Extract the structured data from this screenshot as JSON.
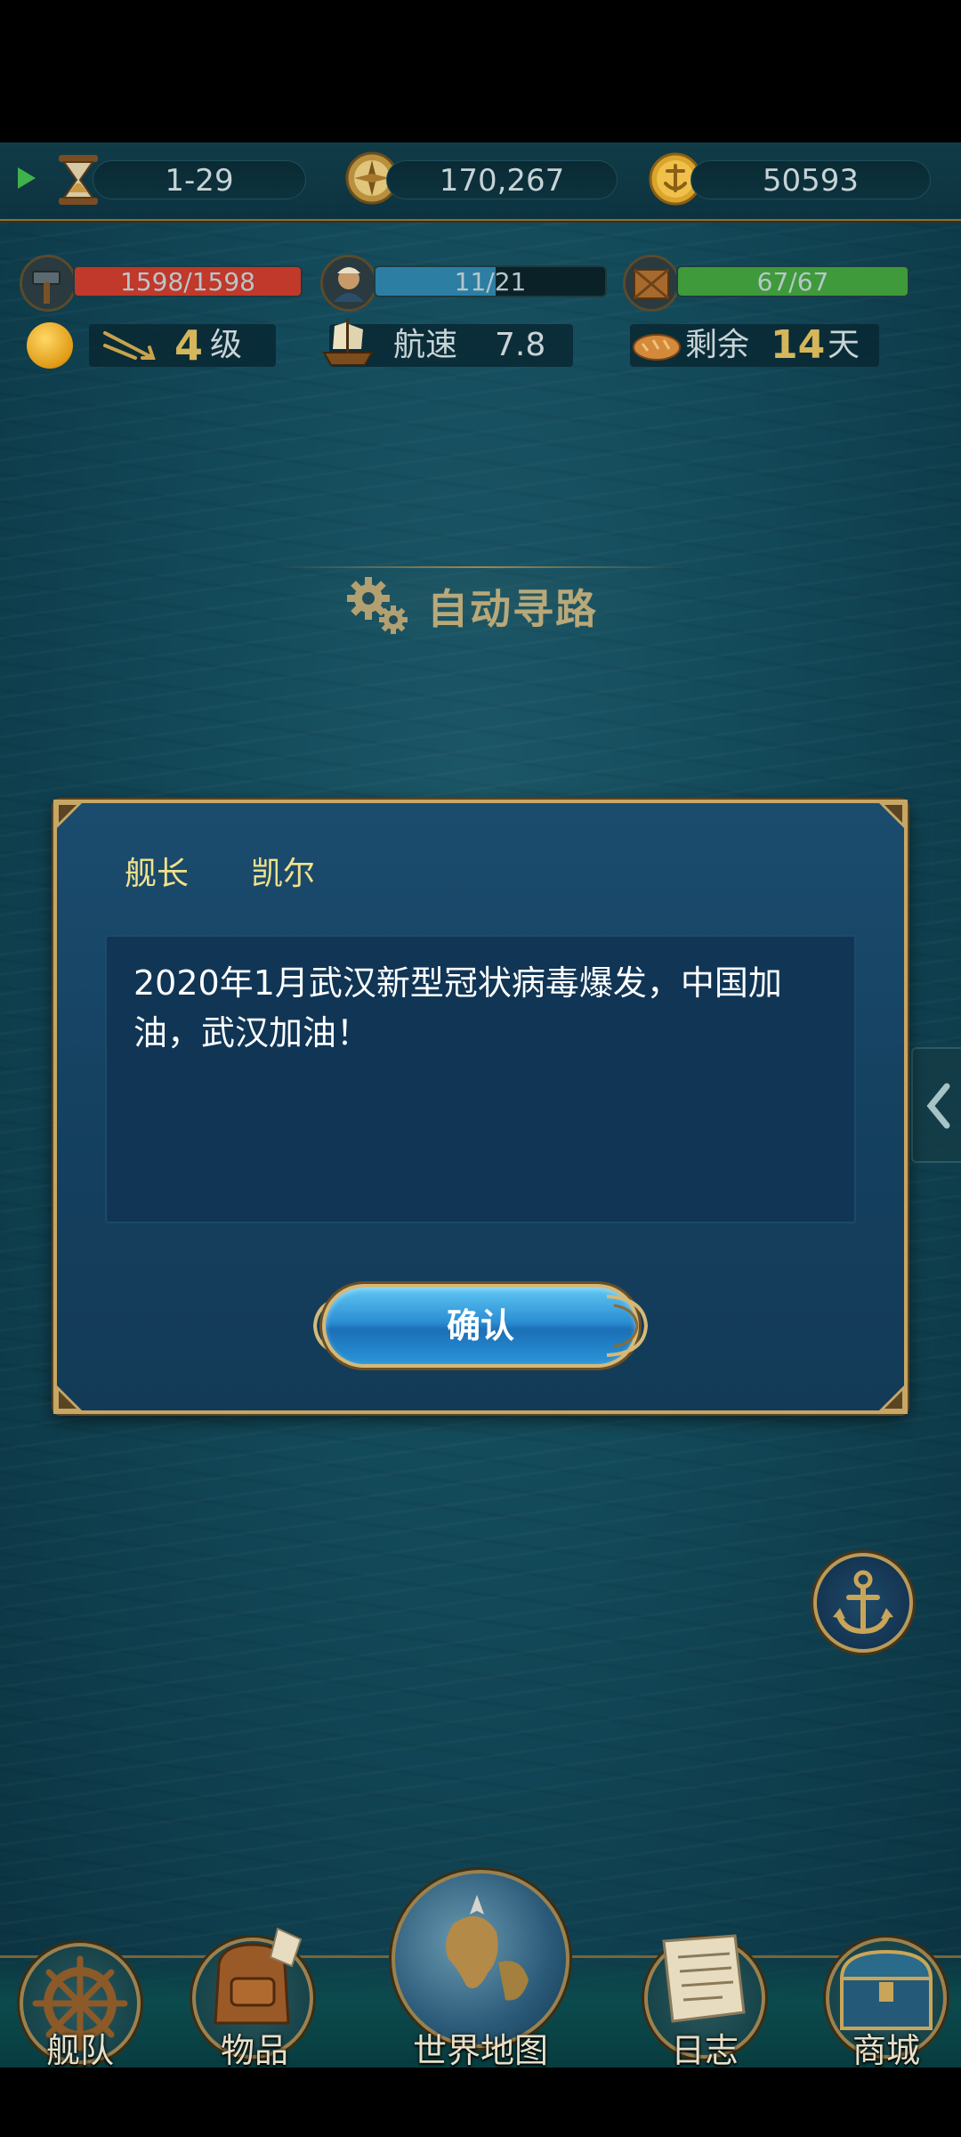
{
  "topbar": {
    "level_progress": "1-29",
    "gold": "170,267",
    "coins": "50593"
  },
  "status": {
    "durability": {
      "text": "1598/1598",
      "current": 1598,
      "max": 1598,
      "color": "#c0392b"
    },
    "crew": {
      "text": "11/21",
      "current": 11,
      "max": 21,
      "color": "#2d7ea3"
    },
    "cargo": {
      "text": "67/67",
      "current": 67,
      "max": 67,
      "color": "#3e9a3a"
    },
    "rank_value": "4",
    "rank_unit": "级",
    "speed_label": "航速",
    "speed_value": "7.8",
    "days_label": "剩余",
    "days_value": "14",
    "days_unit": "天"
  },
  "auto_path": {
    "label": "自动寻路"
  },
  "dialog": {
    "speaker_role": "舰长",
    "speaker_name": "凯尔",
    "message": "2020年1月武汉新型冠状病毒爆发，中国加油，武汉加油！",
    "confirm_label": "确认"
  },
  "nav": {
    "fleet": "舰队",
    "items": "物品",
    "world_map": "世界地图",
    "log": "日志",
    "shop": "商城"
  },
  "colors": {
    "gold_trim": "#c7a766",
    "dialog_bg": "#174466",
    "button_blue": "#2b8ed3",
    "speaker_text": "#f2e18a"
  }
}
